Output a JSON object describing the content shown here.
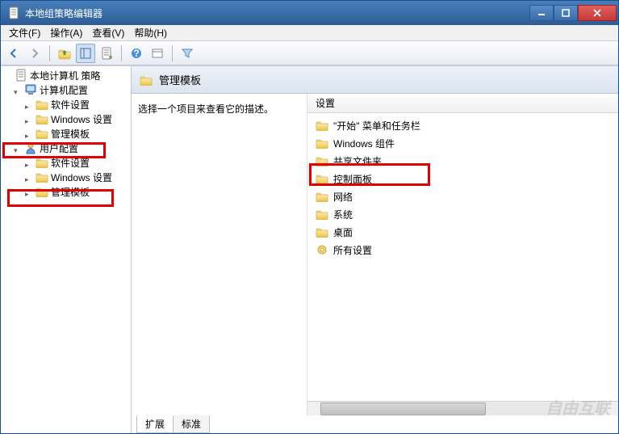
{
  "window": {
    "title": "本地组策略编辑器"
  },
  "menu": {
    "file": "文件(F)",
    "action": "操作(A)",
    "view": "查看(V)",
    "help": "帮助(H)"
  },
  "tree": {
    "root": "本地计算机 策略",
    "computer_config": "计算机配置",
    "cc_software": "软件设置",
    "cc_windows": "Windows 设置",
    "cc_admin": "管理模板",
    "user_config": "用户配置",
    "uc_software": "软件设置",
    "uc_windows": "Windows 设置",
    "uc_admin": "管理模板"
  },
  "right": {
    "header": "管理模板",
    "desc": "选择一个项目来查看它的描述。",
    "col_setting": "设置",
    "items": [
      "\"开始\" 菜单和任务栏",
      "Windows 组件",
      "共享文件夹",
      "控制面板",
      "网络",
      "系统",
      "桌面",
      "所有设置"
    ]
  },
  "tabs": {
    "extended": "扩展",
    "standard": "标准"
  },
  "watermark": "自由互联"
}
